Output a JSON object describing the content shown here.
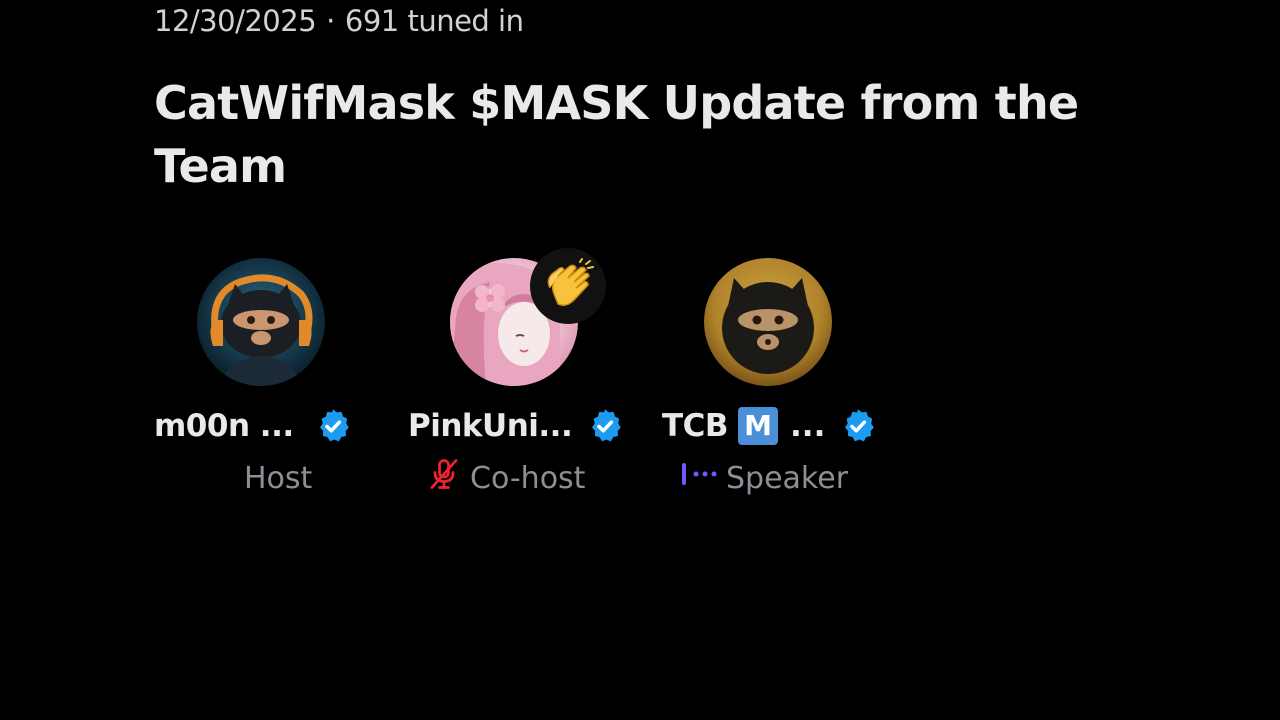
{
  "space": {
    "date": "12/30/2025",
    "separator": "·",
    "listeners": "691 tuned in",
    "title": "CatWifMask $MASK Update from the Team"
  },
  "participants": [
    {
      "name": "m00n ...",
      "role": "Host",
      "verified": true,
      "avatar": "masked-cat-headphones-avatar"
    },
    {
      "name": "PinkUni...",
      "role": "Co-host",
      "verified": true,
      "muted": true,
      "reaction": "clapping-hands-emoji",
      "avatar": "pink-haired-girl-flower-avatar"
    },
    {
      "name": "TCB",
      "badge": "M",
      "ellipsis": "...",
      "role": "Speaker",
      "verified": true,
      "speaking": true,
      "avatar": "masked-cat-gold-avatar"
    }
  ],
  "colors": {
    "background": "#000000",
    "text_primary": "#e7e9ea",
    "text_secondary": "#8b9096",
    "verified_blue": "#1d9bf0",
    "muted_red": "#f4212e",
    "speaking_purple": "#7856ff",
    "m_badge_blue": "#4a8fd8"
  }
}
